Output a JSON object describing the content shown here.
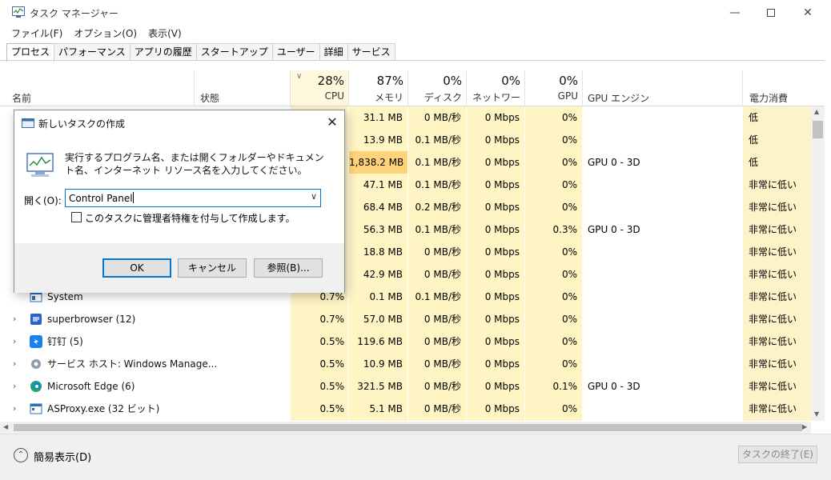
{
  "window": {
    "title": "タスク マネージャー"
  },
  "menu": [
    "ファイル(F)",
    "オプション(O)",
    "表示(V)"
  ],
  "tabs": [
    "プロセス",
    "パフォーマンス",
    "アプリの履歴",
    "スタートアップ",
    "ユーザー",
    "詳細",
    "サービス"
  ],
  "columns": {
    "name": "名前",
    "status": "状態",
    "cpu": {
      "pct": "28%",
      "label": "CPU"
    },
    "memory": {
      "pct": "87%",
      "label": "メモリ"
    },
    "disk": {
      "pct": "0%",
      "label": "ディスク"
    },
    "network": {
      "pct": "0%",
      "label": "ネットワーク"
    },
    "gpu": {
      "pct": "0%",
      "label": "GPU"
    },
    "gpu_engine": "GPU エンジン",
    "power": "電力消費"
  },
  "colors": {
    "cpu_bg": "#fff4c4",
    "mem_heat": "#ffd37a",
    "power_bg": "#fcf0c0",
    "accent": "#0078d7"
  },
  "rows": [
    {
      "name": "",
      "cpu": "",
      "mem": "31.1 MB",
      "disk": "0 MB/秒",
      "net": "0 Mbps",
      "gpu": "0%",
      "gpu_engine": "",
      "power": "低"
    },
    {
      "name": "",
      "cpu": "",
      "mem": "13.9 MB",
      "disk": "0.1 MB/秒",
      "net": "0 Mbps",
      "gpu": "0%",
      "gpu_engine": "",
      "power": "低"
    },
    {
      "name": "",
      "cpu": "",
      "mem": "1,838.2 MB",
      "disk": "0.1 MB/秒",
      "net": "0 Mbps",
      "gpu": "0%",
      "gpu_engine": "GPU 0 - 3D",
      "power": "低"
    },
    {
      "name": "",
      "cpu": "",
      "mem": "47.1 MB",
      "disk": "0.1 MB/秒",
      "net": "0 Mbps",
      "gpu": "0%",
      "gpu_engine": "",
      "power": "非常に低い"
    },
    {
      "name": "",
      "cpu": "",
      "mem": "68.4 MB",
      "disk": "0.2 MB/秒",
      "net": "0 Mbps",
      "gpu": "0%",
      "gpu_engine": "",
      "power": "非常に低い"
    },
    {
      "name": "",
      "cpu": "",
      "mem": "56.3 MB",
      "disk": "0.1 MB/秒",
      "net": "0 Mbps",
      "gpu": "0.3%",
      "gpu_engine": "GPU 0 - 3D",
      "power": "非常に低い"
    },
    {
      "name": "",
      "cpu": "",
      "mem": "18.8 MB",
      "disk": "0 MB/秒",
      "net": "0 Mbps",
      "gpu": "0%",
      "gpu_engine": "",
      "power": "非常に低い"
    },
    {
      "name": "",
      "cpu": "",
      "mem": "42.9 MB",
      "disk": "0 MB/秒",
      "net": "0 Mbps",
      "gpu": "0%",
      "gpu_engine": "",
      "power": "非常に低い"
    },
    {
      "name": "System",
      "cpu": "0.7%",
      "mem": "0.1 MB",
      "disk": "0.1 MB/秒",
      "net": "0 Mbps",
      "gpu": "0%",
      "gpu_engine": "",
      "power": "非常に低い",
      "icon": "system-icon"
    },
    {
      "name": "superbrowser (12)",
      "cpu": "0.7%",
      "mem": "57.0 MB",
      "disk": "0 MB/秒",
      "net": "0 Mbps",
      "gpu": "0%",
      "gpu_engine": "",
      "power": "非常に低い",
      "icon": "browser-icon",
      "expandable": true
    },
    {
      "name": "钉钉 (5)",
      "cpu": "0.5%",
      "mem": "119.6 MB",
      "disk": "0 MB/秒",
      "net": "0 Mbps",
      "gpu": "0%",
      "gpu_engine": "",
      "power": "非常に低い",
      "icon": "dingtalk-icon",
      "expandable": true
    },
    {
      "name": "サービス ホスト: Windows Manage...",
      "cpu": "0.5%",
      "mem": "10.9 MB",
      "disk": "0 MB/秒",
      "net": "0 Mbps",
      "gpu": "0%",
      "gpu_engine": "",
      "power": "非常に低い",
      "icon": "gear-icon",
      "expandable": true
    },
    {
      "name": "Microsoft Edge (6)",
      "cpu": "0.5%",
      "mem": "321.5 MB",
      "disk": "0 MB/秒",
      "net": "0 Mbps",
      "gpu": "0.1%",
      "gpu_engine": "GPU 0 - 3D",
      "power": "非常に低い",
      "icon": "edge-icon",
      "expandable": true
    },
    {
      "name": "ASProxy.exe (32 ビット)",
      "cpu": "0.5%",
      "mem": "5.1 MB",
      "disk": "0 MB/秒",
      "net": "0 Mbps",
      "gpu": "0%",
      "gpu_engine": "",
      "power": "非常に低い",
      "icon": "app-window-icon",
      "expandable": true
    }
  ],
  "footer": {
    "fewer_details": "簡易表示(D)",
    "end_task": "タスクの終了(E)"
  },
  "dialog": {
    "title": "新しいタスクの作成",
    "description": "実行するプログラム名、または開くフォルダーやドキュメント名、インターネット リソース名を入力してください。",
    "open_label": "開く(O):",
    "input_value": "Control Panel",
    "admin_checkbox": "このタスクに管理者特権を付与して作成します。",
    "ok": "OK",
    "cancel": "キャンセル",
    "browse": "参照(B)..."
  }
}
